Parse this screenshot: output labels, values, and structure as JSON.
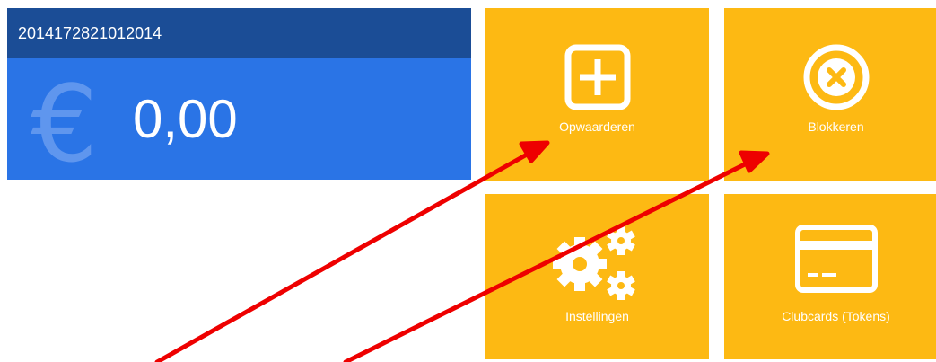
{
  "account": {
    "card_number": "2014172821012014",
    "currency_symbol": "€",
    "balance": "0,00"
  },
  "tiles": [
    {
      "label": "Opwaarderen",
      "icon": "plus-square-icon"
    },
    {
      "label": "Blokkeren",
      "icon": "x-circle-icon"
    },
    {
      "label": "Instellingen",
      "icon": "gears-icon"
    },
    {
      "label": "Clubcards (Tokens)",
      "icon": "credit-card-icon"
    }
  ],
  "annotations": {
    "arrow_color": "#ee0000",
    "arrows": [
      "opwaarderen-arrow",
      "blokkeren-arrow"
    ]
  },
  "colors": {
    "card_header": "#1b4d96",
    "card_body": "#2a74e6",
    "tile": "#fdb913"
  }
}
